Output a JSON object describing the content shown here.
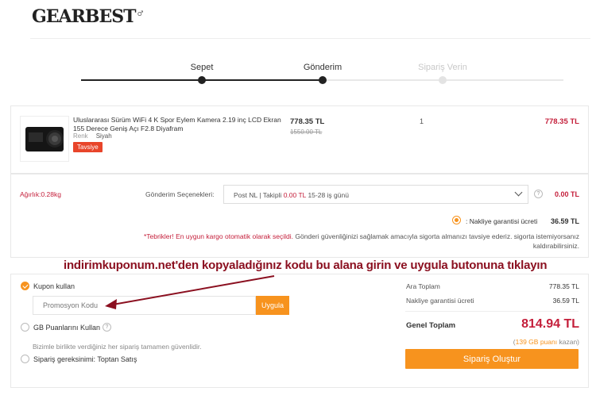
{
  "header": {
    "logo": "GearBest",
    "logo_mark": "♂"
  },
  "steps": [
    {
      "label": "Sepet",
      "state": "done"
    },
    {
      "label": "Gönderim",
      "state": "current"
    },
    {
      "label": "Sipariş Verin",
      "state": "pending"
    }
  ],
  "product": {
    "title": "Uluslararası Sürüm WiFi 4 K Spor Eylem Kamera 2.19 inç LCD Ekran 155 Derece Geniş Açı F2.8 Diyafram",
    "color_label": "Renk",
    "color_value": "Siyah",
    "badge": "Tavsiye",
    "price": "778.35 TL",
    "old_price": "1550.00 TL",
    "qty": "1",
    "total": "778.35 TL"
  },
  "shipping": {
    "weight": "Ağırlık:0.28kg",
    "options_label": "Gönderim Seçenekleri:",
    "selected_prefix": "Post NL | Takipli",
    "selected_cost": "0.00 TL",
    "selected_days": "15-28 iş günü",
    "help": "?",
    "cost": "0.00 TL",
    "insurance_label": ": Nakliye garantisi ücreti",
    "insurance_cost": "36.59 TL",
    "notice_prefix": "*Tebrikler! En uygun kargo otomatik olarak seçildi.",
    "notice_rest": "Gönderi güvenliğinizi sağlamak amacıyla sigorta almanızı tavsiye ederiz. sigorta istemiyorsanız kaldırabilirsiniz."
  },
  "annotation": "indirimkuponum.net'den kopyaladığınız kodu bu alana girin ve uygula butonuna tıklayın",
  "coupon": {
    "use_label": "Kupon kullan",
    "placeholder": "Promosyon Kodu",
    "apply": "Uygula",
    "gb_points_label": "GB Puanlarını Kullan",
    "secure_text": "Bizimle birlikte verdiğiniz her sipariş tamamen güvenlidir.",
    "wholesale_label": "Sipariş gereksinimi: Toptan Satış"
  },
  "summary": {
    "subtotal_label": "Ara Toplam",
    "subtotal": "778.35 TL",
    "insurance_label": "Nakliye garantisi ücreti",
    "insurance": "36.59 TL",
    "total_label": "Genel Toplam",
    "total": "814.94 TL",
    "points_prefix": "(",
    "points_value": "139 GB puanı",
    "points_suffix": "kazan)",
    "order_button": "Sipariş Oluştur"
  },
  "colors": {
    "accent": "#f7931e",
    "price_red": "#c41e3a",
    "annotation": "#8b1020"
  }
}
